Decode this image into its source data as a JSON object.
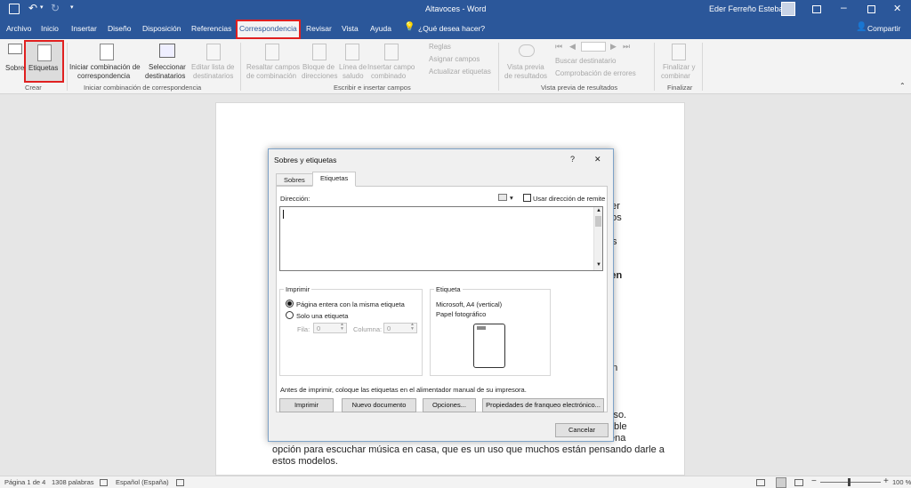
{
  "window": {
    "title": "Altavoces - Word",
    "user": "Eder Ferreño Esteban"
  },
  "menu": {
    "tabs": [
      "Archivo",
      "Inicio",
      "Insertar",
      "Diseño",
      "Disposición",
      "Referencias",
      "Correspondencia",
      "Revisar",
      "Vista",
      "Ayuda"
    ],
    "tell_me": "¿Qué desea hacer?",
    "share": "Compartir"
  },
  "ribbon": {
    "crear": {
      "sobres": "Sobres",
      "etiquetas": "Etiquetas",
      "group": "Crear"
    },
    "iniciar": {
      "iniciar_combinacion": "Iniciar combinación de",
      "iniciar_combinacion2": "correspondencia",
      "seleccionar": "Seleccionar",
      "seleccionar2": "destinatarios",
      "editar": "Editar lista de",
      "editar2": "destinatarios",
      "group": "Iniciar combinación de correspondencia"
    },
    "escribir": {
      "resaltar": "Resaltar campos",
      "resaltar2": "de combinación",
      "bloque": "Bloque de",
      "bloque2": "direcciones",
      "linea": "Línea de",
      "linea2": "saludo",
      "insertar": "Insertar campo",
      "insertar2": "combinado",
      "reglas": "Reglas",
      "asignar": "Asignar campos",
      "actualizar": "Actualizar etiquetas",
      "group": "Escribir e insertar campos"
    },
    "vista": {
      "vista_previa": "Vista previa",
      "vista_previa2": "de resultados",
      "buscar": "Buscar destinatario",
      "comprobacion": "Comprobación de errores",
      "group": "Vista previa de resultados"
    },
    "finalizar": {
      "finalizar": "Finalizar y",
      "finalizar2": "combinar",
      "group": "Finalizar"
    }
  },
  "document": {
    "fragments": [
      "ner",
      "nos",
      "s",
      "r en",
      "en",
      "lso.",
      "ble",
      "ena"
    ],
    "line1": "opción para escuchar música en casa, que es un uso que muchos están pensando darle a",
    "line2": "estos modelos."
  },
  "dialog": {
    "title": "Sobres y etiquetas",
    "help": "?",
    "close": "✕",
    "tabs": [
      "Sobres",
      "Etiquetas"
    ],
    "direccion_label": "Dirección:",
    "usar_remite": "Usar dirección de remite",
    "imprimir_group": "Imprimir",
    "pagina_entera": "Página entera con la misma etiqueta",
    "solo_una": "Solo una etiqueta",
    "fila": "Fila:",
    "fila_value": "0",
    "columna": "Columna:",
    "columna_value": "0",
    "etiqueta_group": "Etiqueta",
    "etiqueta_line1": "Microsoft, A4 (vertical)",
    "etiqueta_line2": "Papel fotográfico",
    "nota": "Antes de imprimir, coloque las etiquetas en el alimentador manual de su impresora.",
    "btn_imprimir": "Imprimir",
    "btn_nuevo": "Nuevo documento",
    "btn_opciones": "Opciones...",
    "btn_propiedades": "Propiedades de franqueo electrónico...",
    "btn_cancelar": "Cancelar"
  },
  "status": {
    "page": "Página 1 de 4",
    "words": "1308 palabras",
    "language": "Español (España)",
    "zoom": "100 %"
  },
  "colors": {
    "brand": "#2b579a",
    "highlight": "#e02020"
  }
}
